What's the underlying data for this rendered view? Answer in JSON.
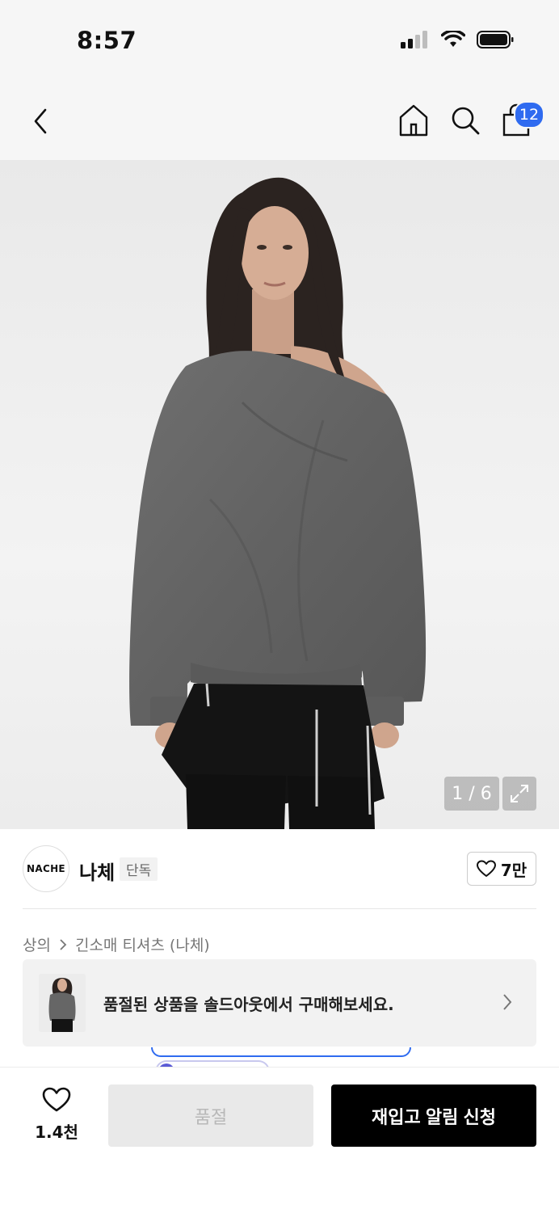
{
  "status_bar": {
    "time": "8:57"
  },
  "nav": {
    "cart_count": "12"
  },
  "gallery": {
    "counter": "1 / 6"
  },
  "brand": {
    "logo_text": "NACHE",
    "name": "나체",
    "tag": "단독",
    "likes": "7만"
  },
  "breadcrumb": {
    "category": "상의",
    "product": "긴소매 티셔츠 (나체)"
  },
  "soldout_banner": {
    "text": "품절된 상품을 솔드아웃에서 구매해보세요."
  },
  "bottom_bar": {
    "wish_count": "1.4천",
    "soldout_label": "품절",
    "restock_label": "재입고 알림 신청"
  },
  "colors": {
    "accent": "#2f6bf0",
    "primary_button": "#000000",
    "disabled_button": "#e9e9e9"
  }
}
